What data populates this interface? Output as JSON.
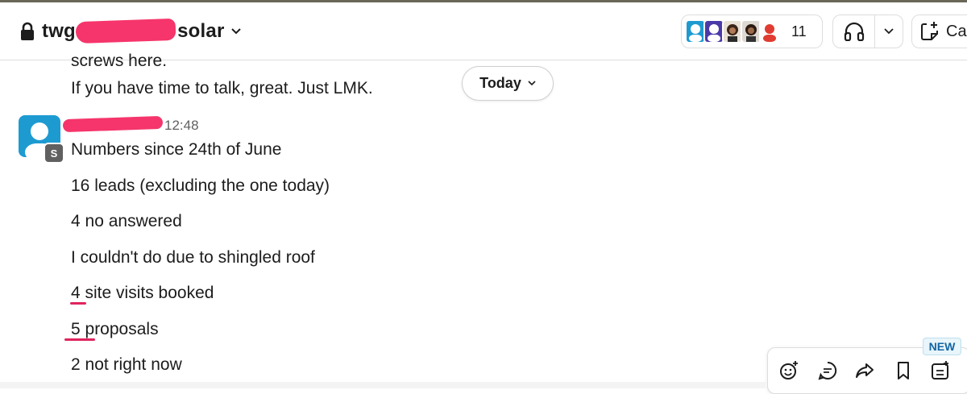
{
  "header": {
    "channel_prefix": "twg-",
    "channel_suffix": "solar",
    "member_count": "11",
    "canvas_label": "Ca"
  },
  "messages": {
    "prev_line1": "screws here.",
    "prev_line2": "If you have time to talk, great. Just LMK.",
    "date_divider": "Today",
    "time": "12:48",
    "badge": "S",
    "lines": [
      "Numbers since 24th of June",
      "16 leads (excluding the one today)",
      "4 no answered",
      "I couldn't do due to shingled roof",
      "4 site visits booked",
      "5 proposals",
      "2 not right now"
    ]
  },
  "actions": {
    "new_badge": "NEW"
  },
  "colors": {
    "redaction": "#f5356b",
    "underline": "#e0245e",
    "avatar": "#1d9bd1"
  }
}
